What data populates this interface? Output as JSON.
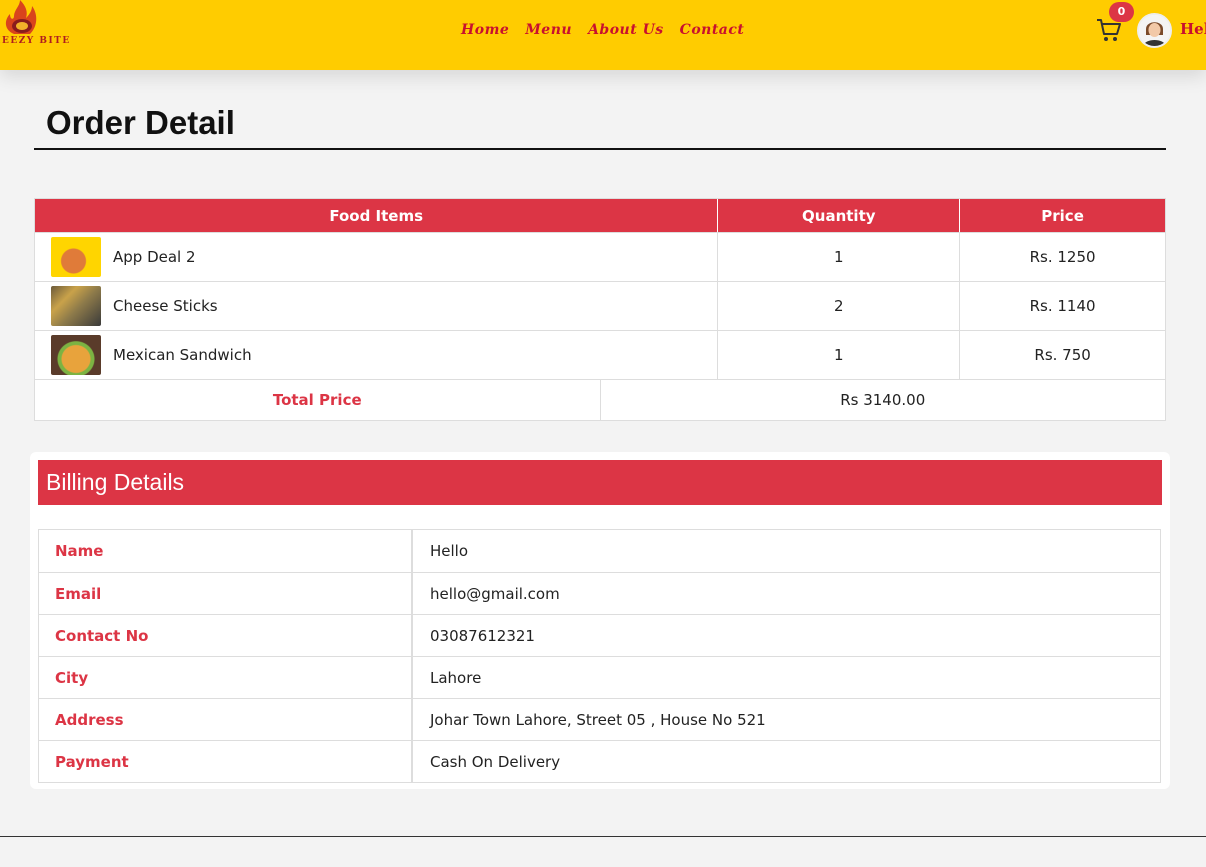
{
  "navbar": {
    "logo_text": "HEEZY BITE",
    "links": [
      "Home",
      "Menu",
      "About Us",
      "Contact"
    ],
    "cart_count": "0",
    "user_name": "Hello"
  },
  "page": {
    "title": "Order Detail"
  },
  "order": {
    "headers": [
      "Food Items",
      "Quantity",
      "Price"
    ],
    "items": [
      {
        "name": "App Deal 2",
        "quantity": "1",
        "price": "Rs. 1250"
      },
      {
        "name": "Cheese Sticks",
        "quantity": "2",
        "price": "Rs. 1140"
      },
      {
        "name": "Mexican Sandwich",
        "quantity": "1",
        "price": "Rs. 750"
      }
    ],
    "total_label": "Total Price",
    "total_value": "Rs 3140.00"
  },
  "billing": {
    "title": "Billing Details",
    "rows": [
      {
        "label": "Name",
        "value": "Hello"
      },
      {
        "label": "Email",
        "value": "hello@gmail.com"
      },
      {
        "label": "Contact No",
        "value": "03087612321"
      },
      {
        "label": "City",
        "value": "Lahore"
      },
      {
        "label": "Address",
        "value": "Johar Town Lahore, Street 05 , House No 521"
      },
      {
        "label": "Payment",
        "value": "Cash On Delivery"
      }
    ]
  },
  "colors": {
    "navbar": "#ffcc00",
    "accent": "#dc3545",
    "link": "#c8102e"
  }
}
